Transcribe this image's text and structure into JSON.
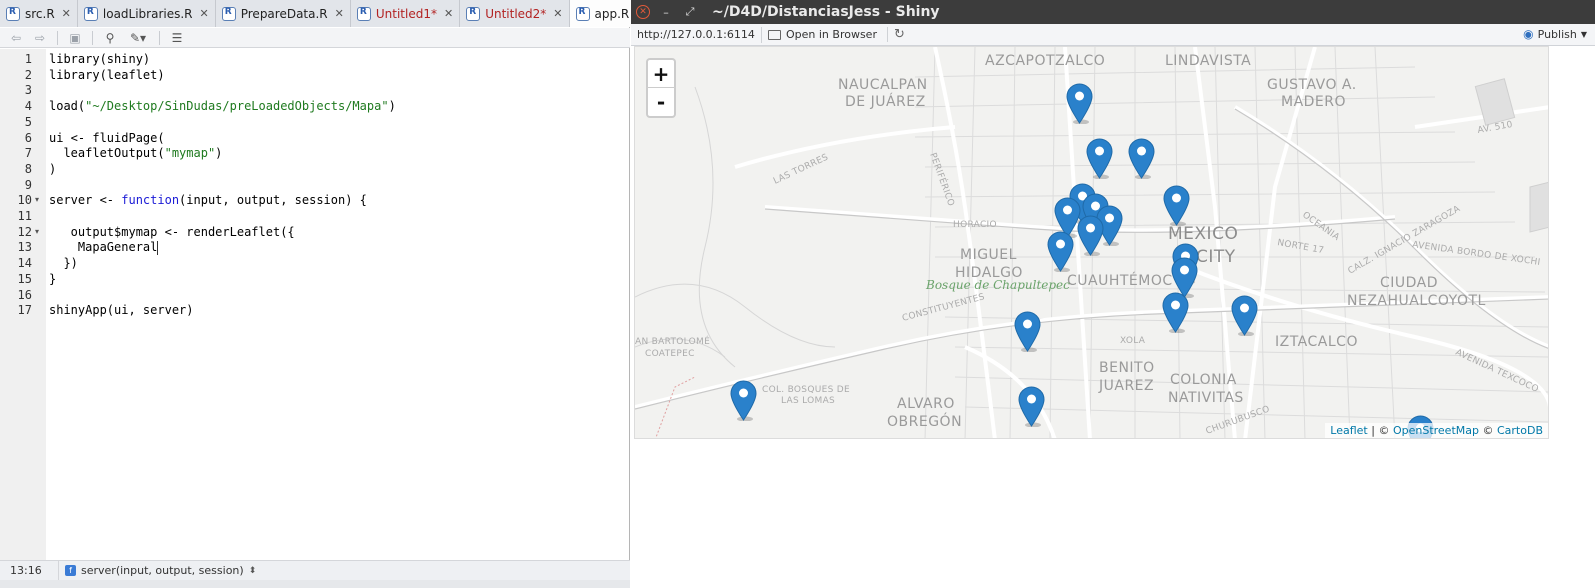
{
  "editor": {
    "tabs": [
      {
        "label": "src.R",
        "modified": false,
        "active": false
      },
      {
        "label": "loadLibraries.R",
        "modified": false,
        "active": false
      },
      {
        "label": "PrepareData.R",
        "modified": false,
        "active": false
      },
      {
        "label": "Untitled1*",
        "modified": true,
        "active": false
      },
      {
        "label": "Untitled2*",
        "modified": true,
        "active": false
      },
      {
        "label": "app.R",
        "modified": false,
        "active": true
      }
    ],
    "code_lines": [
      "library(shiny)",
      "library(leaflet)",
      "",
      "load(\"~/Desktop/SinDudas/preLoadedObjects/Mapa\")",
      "",
      "ui <- fluidPage(",
      "  leafletOutput(\"mymap\")",
      ")",
      "",
      "server <- function(input, output, session) {",
      "",
      "   output$mymap <- renderLeaflet({",
      "    MapaGeneral",
      "  })",
      "}",
      "",
      "shinyApp(ui, server)"
    ],
    "line_numbers": [
      "1",
      "2",
      "3",
      "4",
      "5",
      "6",
      "7",
      "8",
      "9",
      "10",
      "11",
      "12",
      "13",
      "14",
      "15",
      "16",
      "17"
    ],
    "status": {
      "cursor_position": "13:16",
      "scope": "server(input, output, session)"
    }
  },
  "viewer": {
    "window_title": "~/D4D/DistanciasJess - Shiny",
    "url": "http://127.0.0.1:6114",
    "open_in_browser_label": "Open in Browser",
    "publish_label": "Publish",
    "map": {
      "zoom_in_label": "+",
      "zoom_out_label": "-",
      "labels": [
        {
          "text": "AZCAPOTZALCO",
          "kind": "district"
        },
        {
          "text": "LINDAVISTA",
          "kind": "district"
        },
        {
          "text": "NAUCALPAN",
          "kind": "district"
        },
        {
          "text": "DE JUÁREZ",
          "kind": "district"
        },
        {
          "text": "GUSTAVO A.",
          "kind": "district"
        },
        {
          "text": "MADERO",
          "kind": "district"
        },
        {
          "text": "MEXICO",
          "kind": "city"
        },
        {
          "text": "CITY",
          "kind": "city"
        },
        {
          "text": "MIGUEL",
          "kind": "district"
        },
        {
          "text": "HIDALGO",
          "kind": "district"
        },
        {
          "text": "CUAUHTÉMOC",
          "kind": "district"
        },
        {
          "text": "CIUDAD",
          "kind": "district"
        },
        {
          "text": "NEZAHUALCOYOTL",
          "kind": "district"
        },
        {
          "text": "IZTACALCO",
          "kind": "district"
        },
        {
          "text": "BENITO",
          "kind": "district"
        },
        {
          "text": "JUAREZ",
          "kind": "district"
        },
        {
          "text": "COLONIA",
          "kind": "district"
        },
        {
          "text": "NATIVITAS",
          "kind": "district"
        },
        {
          "text": "ALVARO",
          "kind": "district"
        },
        {
          "text": "OBREGÓN",
          "kind": "district"
        },
        {
          "text": "AN BARTOLOMÉ",
          "kind": "small"
        },
        {
          "text": "COATEPEC",
          "kind": "small"
        },
        {
          "text": "COL. BOSQUES DE",
          "kind": "small"
        },
        {
          "text": "LAS LOMAS",
          "kind": "small"
        },
        {
          "text": "Bosque de Chapultepec",
          "kind": "park"
        },
        {
          "text": "HORACIO",
          "kind": "street"
        },
        {
          "text": "LAS TORRES",
          "kind": "street"
        },
        {
          "text": "PERIFÉRICO",
          "kind": "street"
        },
        {
          "text": "CONSTITUYENTES",
          "kind": "street"
        },
        {
          "text": "XOLA",
          "kind": "street"
        },
        {
          "text": "AV. 510",
          "kind": "street"
        },
        {
          "text": "NORTE 17",
          "kind": "street"
        },
        {
          "text": "OCEANIA",
          "kind": "street"
        },
        {
          "text": "AVENIDA BORDO DE XOCHI",
          "kind": "street"
        },
        {
          "text": "CALZ. IGNACIO ZARAGOZA",
          "kind": "street"
        },
        {
          "text": "AVENIDA TEXCOCO",
          "kind": "street"
        },
        {
          "text": "CHURUBUSCO",
          "kind": "street"
        }
      ],
      "marker_count": 18,
      "attribution": {
        "leaflet": "Leaflet",
        "sep1": " | © ",
        "osm": "OpenStreetMap",
        "sep2": " © ",
        "carto": "CartoDB"
      }
    }
  }
}
